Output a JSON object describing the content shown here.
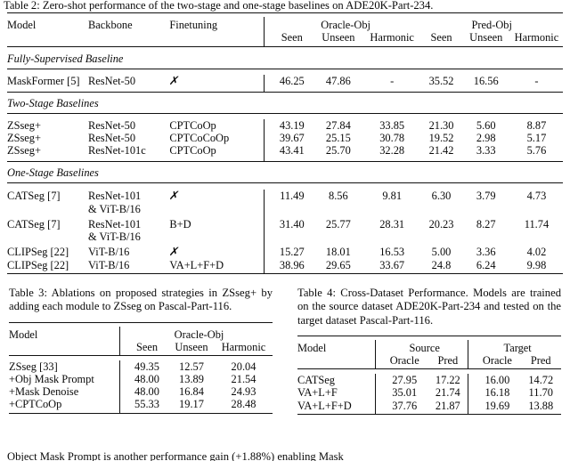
{
  "document": {
    "kind": "academic-paper-tables"
  },
  "table2": {
    "caption": "Table 2: Zero-shot performance of the two-stage and one-stage baselines on ADE20K-Part-234.",
    "columns": [
      "Model",
      "Backbone",
      "Finetuning"
    ],
    "group_headers": [
      "Oracle-Obj",
      "Pred-Obj"
    ],
    "sub_headers": [
      "Seen",
      "Unseen",
      "Harmonic",
      "Seen",
      "Unseen",
      "Harmonic"
    ],
    "sections": [
      {
        "title": "Fully-Supervised Baseline",
        "rows": [
          {
            "model": "MaskFormer [5]",
            "backbone": "ResNet-50",
            "finetuning": "✗",
            "finetuning_is_icon": true,
            "values": [
              "46.25",
              "47.86",
              "-",
              "35.52",
              "16.56",
              "-"
            ],
            "bold": [
              false,
              false,
              false,
              false,
              false,
              false
            ]
          }
        ]
      },
      {
        "title": "Two-Stage Baselines",
        "rows": [
          {
            "model": "ZSseg+",
            "backbone": "ResNet-50",
            "finetuning": "CPTCoOp",
            "values": [
              "43.19",
              "27.84",
              "33.85",
              "21.30",
              "5.60",
              "8.87"
            ],
            "bold": [
              false,
              true,
              true,
              false,
              true,
              true
            ]
          },
          {
            "model": "ZSseg+",
            "backbone": "ResNet-50",
            "finetuning": "CPTCoCoOp",
            "values": [
              "39.67",
              "25.15",
              "30.78",
              "19.52",
              "2.98",
              "5.17"
            ],
            "bold": [
              false,
              false,
              false,
              true,
              false,
              false
            ]
          },
          {
            "model": "ZSseg+",
            "backbone": "ResNet-101c",
            "finetuning": "CPTCoOp",
            "values": [
              "43.41",
              "25.70",
              "32.28",
              "21.42",
              "3.33",
              "5.76"
            ],
            "bold": [
              true,
              false,
              false,
              true,
              false,
              false
            ]
          }
        ]
      },
      {
        "title": "One-Stage Baselines",
        "rows": [
          {
            "model": "CATSeg [7]",
            "backbone": "ResNet-101",
            "backbone2": "& ViT-B/16",
            "finetuning": "✗",
            "finetuning_is_icon": true,
            "values": [
              "11.49",
              "8.56",
              "9.81",
              "6.30",
              "3.79",
              "4.73"
            ],
            "bold": [
              false,
              false,
              false,
              false,
              false,
              false
            ]
          },
          {
            "model": "CATSeg [7]",
            "backbone": "ResNet-101",
            "backbone2": "& ViT-B/16",
            "finetuning": "B+D",
            "values": [
              "31.40",
              "25.77",
              "28.31",
              "20.23",
              "8.27",
              "11.74"
            ],
            "bold": [
              false,
              false,
              false,
              false,
              true,
              true
            ]
          },
          {
            "model": "CLIPSeg [22]",
            "backbone": "ViT-B/16",
            "finetuning": "✗",
            "finetuning_is_icon": true,
            "values": [
              "15.27",
              "18.01",
              "16.53",
              "5.00",
              "3.36",
              "4.02"
            ],
            "bold": [
              false,
              false,
              false,
              false,
              false,
              false
            ]
          },
          {
            "model": "CLIPSeg [22]",
            "backbone": "ViT-B/16",
            "finetuning": "VA+L+F+D",
            "values": [
              "38.96",
              "29.65",
              "33.67",
              "24.8",
              "6.24",
              "9.98"
            ],
            "bold": [
              true,
              true,
              true,
              true,
              false,
              false
            ]
          }
        ]
      }
    ]
  },
  "table3": {
    "caption": "Table 3: Ablations on proposed strategies in ZSseg+ by adding each module to ZSseg on Pascal-Part-116.",
    "group_header": "Oracle-Obj",
    "columns": [
      "Model",
      "Seen",
      "Unseen",
      "Harmonic"
    ],
    "rows": [
      {
        "model": "ZSseg [33]",
        "values": [
          "49.35",
          "12.57",
          "20.04"
        ]
      },
      {
        "model": "+Obj Mask Prompt",
        "values": [
          "48.00",
          "13.89",
          "21.54"
        ]
      },
      {
        "model": "+Mask Denoise",
        "values": [
          "48.00",
          "16.84",
          "24.93"
        ]
      },
      {
        "model": "+CPTCoOp",
        "values": [
          "55.33",
          "19.17",
          "28.48"
        ]
      }
    ]
  },
  "table4": {
    "caption": "Table 4: Cross-Dataset Performance. Models are trained on the source dataset ADE20K-Part-234 and tested on the target dataset Pascal-Part-116.",
    "group_headers": [
      "Source",
      "Target"
    ],
    "columns": [
      "Model",
      "Oracle",
      "Pred",
      "Oracle",
      "Pred"
    ],
    "rows": [
      {
        "model": "CATSeg",
        "values": [
          "27.95",
          "17.22",
          "16.00",
          "14.72"
        ],
        "bold": [
          false,
          false,
          false,
          true
        ]
      },
      {
        "model": "VA+L+F",
        "values": [
          "35.01",
          "21.74",
          "16.18",
          "11.70"
        ],
        "bold": [
          false,
          false,
          false,
          false
        ]
      },
      {
        "model": "VA+L+F+D",
        "values": [
          "37.76",
          "21.87",
          "19.69",
          "13.88"
        ],
        "bold": [
          true,
          true,
          true,
          false
        ]
      }
    ]
  },
  "body_tail": {
    "text": "Object Mask Prompt is another performance gain (+1.88%) enabling Mask"
  }
}
